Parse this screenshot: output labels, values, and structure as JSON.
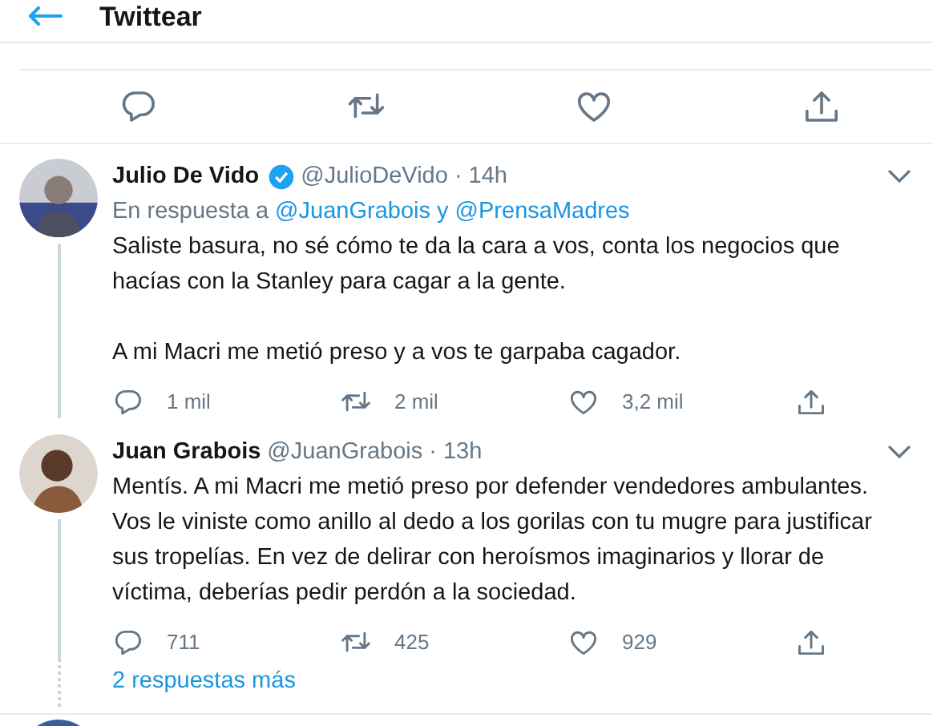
{
  "header": {
    "title": "Twittear"
  },
  "main_actions": [
    {
      "kind": "reply"
    },
    {
      "kind": "retweet"
    },
    {
      "kind": "like"
    },
    {
      "kind": "share"
    }
  ],
  "tweets": [
    {
      "name": "Julio De Vido",
      "verified": true,
      "handle": "@JulioDeVido",
      "time": "· 14h",
      "reply_to": "En respuesta a",
      "reply_mentions": "@JuanGrabois y @PrensaMadres",
      "paragraphs": [
        "Saliste basura, no sé cómo te da la cara a vos, conta los negocios que hacías con la Stanley para cagar a la gente.",
        "A mi Macri me metió preso y a vos te garpaba cagador."
      ],
      "replies": "1 mil",
      "retweets": "2 mil",
      "likes": "3,2 mil"
    },
    {
      "name": "Juan Grabois",
      "verified": false,
      "handle": "@JuanGrabois",
      "time": "· 13h",
      "paragraphs": [
        "Mentís. A mi Macri me metió preso por defender vendedores ambulantes. Vos le viniste como anillo al dedo a los gorilas con tu mugre para justificar sus tropelías. En vez de delirar con heroísmos imaginarios y llorar de víctima, deberías pedir perdón a la sociedad."
      ],
      "replies": "711",
      "retweets": "425",
      "likes": "929"
    }
  ],
  "more_replies": "2 respuestas más"
}
